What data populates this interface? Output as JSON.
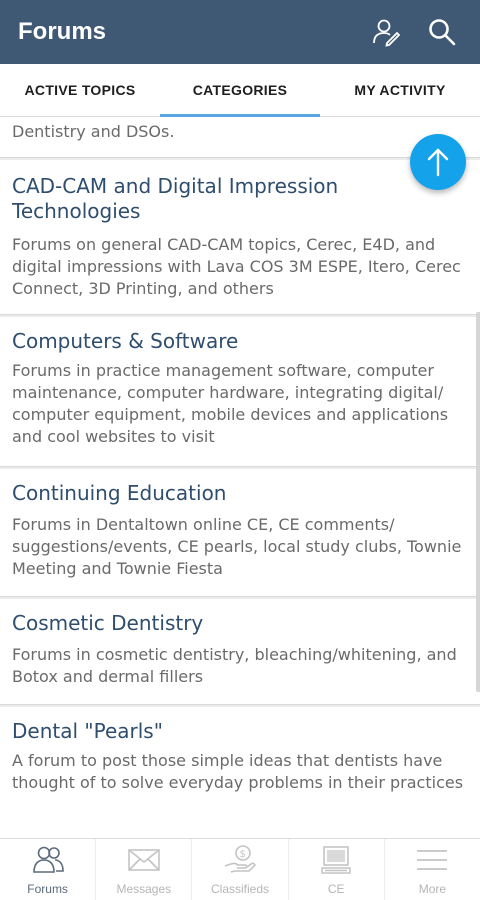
{
  "appbar": {
    "title": "Forums",
    "bg_color": "#3f5874",
    "profile_icon": "user-pen-icon",
    "search_icon": "search-icon"
  },
  "tabs": [
    {
      "label": "ACTIVE TOPICS",
      "active": false
    },
    {
      "label": "CATEGORIES",
      "active": true
    },
    {
      "label": "MY ACTIVITY",
      "active": false
    }
  ],
  "accent_color": "#5aa6e3",
  "fab_color": "#14a3ea",
  "categories": [
    {
      "title": "",
      "desc": "Dentistry and DSOs."
    },
    {
      "title": "CAD-CAM and Digital Impression Technologies",
      "desc": "Forums on general CAD-CAM topics, Cerec, E4D, and digital impressions with Lava COS 3M ESPE, Itero, Cerec Connect, 3D Printing, and others"
    },
    {
      "title": "Computers & Software",
      "desc": "Forums in practice management software, computer maintenance, computer hardware, integrating digital/ computer equipment, mobile devices and applications and cool websites to visit"
    },
    {
      "title": "Continuing Education",
      "desc": "Forums in Dentaltown online CE, CE comments/ suggestions/events, CE pearls, local study clubs, Townie Meeting and Townie Fiesta"
    },
    {
      "title": "Cosmetic Dentistry",
      "desc": "Forums in cosmetic dentistry, bleaching/whitening, and Botox and dermal fillers"
    },
    {
      "title": "Dental \"Pearls\"",
      "desc": "A forum to post those simple ideas that dentists have thought of to solve everyday problems in their practices"
    }
  ],
  "bottomnav": [
    {
      "label": "Forums",
      "icon": "users-icon",
      "active": true
    },
    {
      "label": "Messages",
      "icon": "envelope-icon",
      "active": false
    },
    {
      "label": "Classifieds",
      "icon": "hand-dollar-icon",
      "active": false
    },
    {
      "label": "CE",
      "icon": "computer-icon",
      "active": false
    },
    {
      "label": "More",
      "icon": "menu-icon",
      "active": false
    }
  ]
}
